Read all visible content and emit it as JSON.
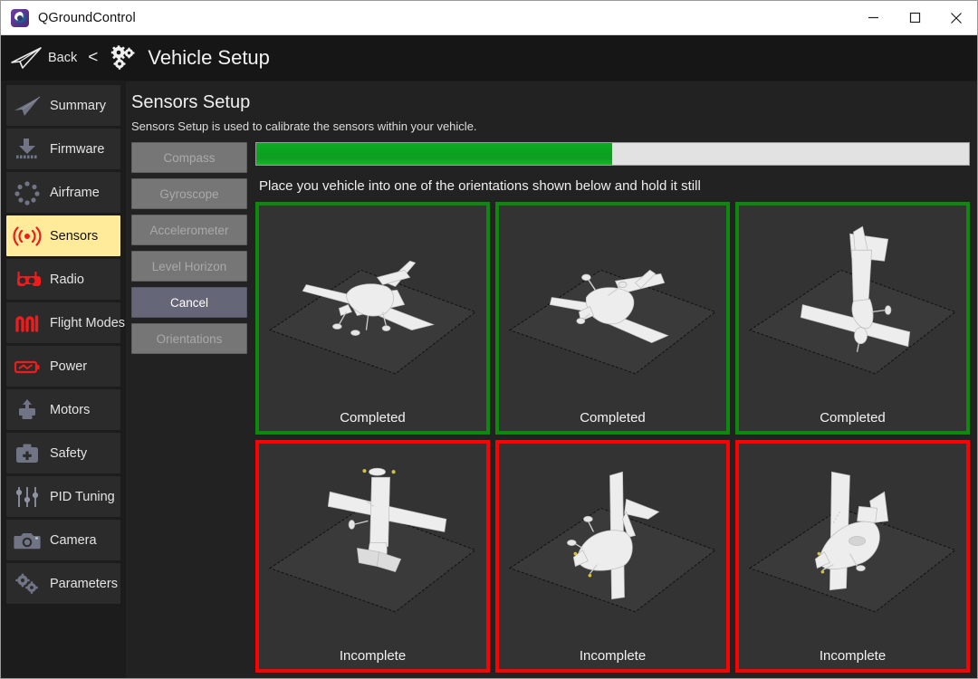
{
  "window": {
    "title": "QGroundControl",
    "app_icon": "qgroundcontrol-logo-icon",
    "controls": {
      "minimize": "minimize-icon",
      "maximize": "maximize-icon",
      "close": "close-icon"
    }
  },
  "header": {
    "plane_icon": "paper-plane-icon",
    "back_label": "Back",
    "chevron": "<",
    "gears_icon": "gears-icon",
    "title": "Vehicle Setup"
  },
  "sidebar": {
    "items": [
      {
        "label": "Summary",
        "icon": "paper-plane-icon",
        "selected": false
      },
      {
        "label": "Firmware",
        "icon": "firmware-download-icon",
        "selected": false
      },
      {
        "label": "Airframe",
        "icon": "airframe-dots-icon",
        "selected": false
      },
      {
        "label": "Sensors",
        "icon": "sensors-signal-icon",
        "selected": true
      },
      {
        "label": "Radio",
        "icon": "radio-controller-icon",
        "selected": false
      },
      {
        "label": "Flight Modes",
        "icon": "flight-modes-wave-icon",
        "selected": false
      },
      {
        "label": "Power",
        "icon": "battery-power-icon",
        "selected": false
      },
      {
        "label": "Motors",
        "icon": "motors-icon",
        "selected": false
      },
      {
        "label": "Safety",
        "icon": "safety-kit-icon",
        "selected": false
      },
      {
        "label": "PID Tuning",
        "icon": "sliders-icon",
        "selected": false
      },
      {
        "label": "Camera",
        "icon": "camera-icon",
        "selected": false
      },
      {
        "label": "Parameters",
        "icon": "gears-icon",
        "selected": false
      }
    ]
  },
  "main": {
    "title": "Sensors Setup",
    "subtitle": "Sensors Setup is used to calibrate the sensors within your vehicle.",
    "calibration_buttons": [
      {
        "label": "Compass",
        "enabled": false
      },
      {
        "label": "Gyroscope",
        "enabled": false
      },
      {
        "label": "Accelerometer",
        "enabled": false
      },
      {
        "label": "Level Horizon",
        "enabled": false
      },
      {
        "label": "Cancel",
        "enabled": true
      },
      {
        "label": "Orientations",
        "enabled": false
      }
    ],
    "progress": {
      "percent": 50,
      "fill_color": "#0aa520",
      "track_color": "#e2e2e2"
    },
    "instruction": "Place you vehicle into one of the orientations shown below and hold it still",
    "orientations": [
      {
        "status": "Completed",
        "state": "completed",
        "pose": "level",
        "border_color": "#0d8a0d"
      },
      {
        "status": "Completed",
        "state": "completed",
        "pose": "upside-down",
        "border_color": "#0d8a0d"
      },
      {
        "status": "Completed",
        "state": "completed",
        "pose": "nose-down",
        "border_color": "#0d8a0d"
      },
      {
        "status": "Incomplete",
        "state": "incomplete",
        "pose": "nose-up",
        "border_color": "#ff0000"
      },
      {
        "status": "Incomplete",
        "state": "incomplete",
        "pose": "left-side",
        "border_color": "#ff0000"
      },
      {
        "status": "Incomplete",
        "state": "incomplete",
        "pose": "right-side",
        "border_color": "#ff0000"
      }
    ]
  }
}
